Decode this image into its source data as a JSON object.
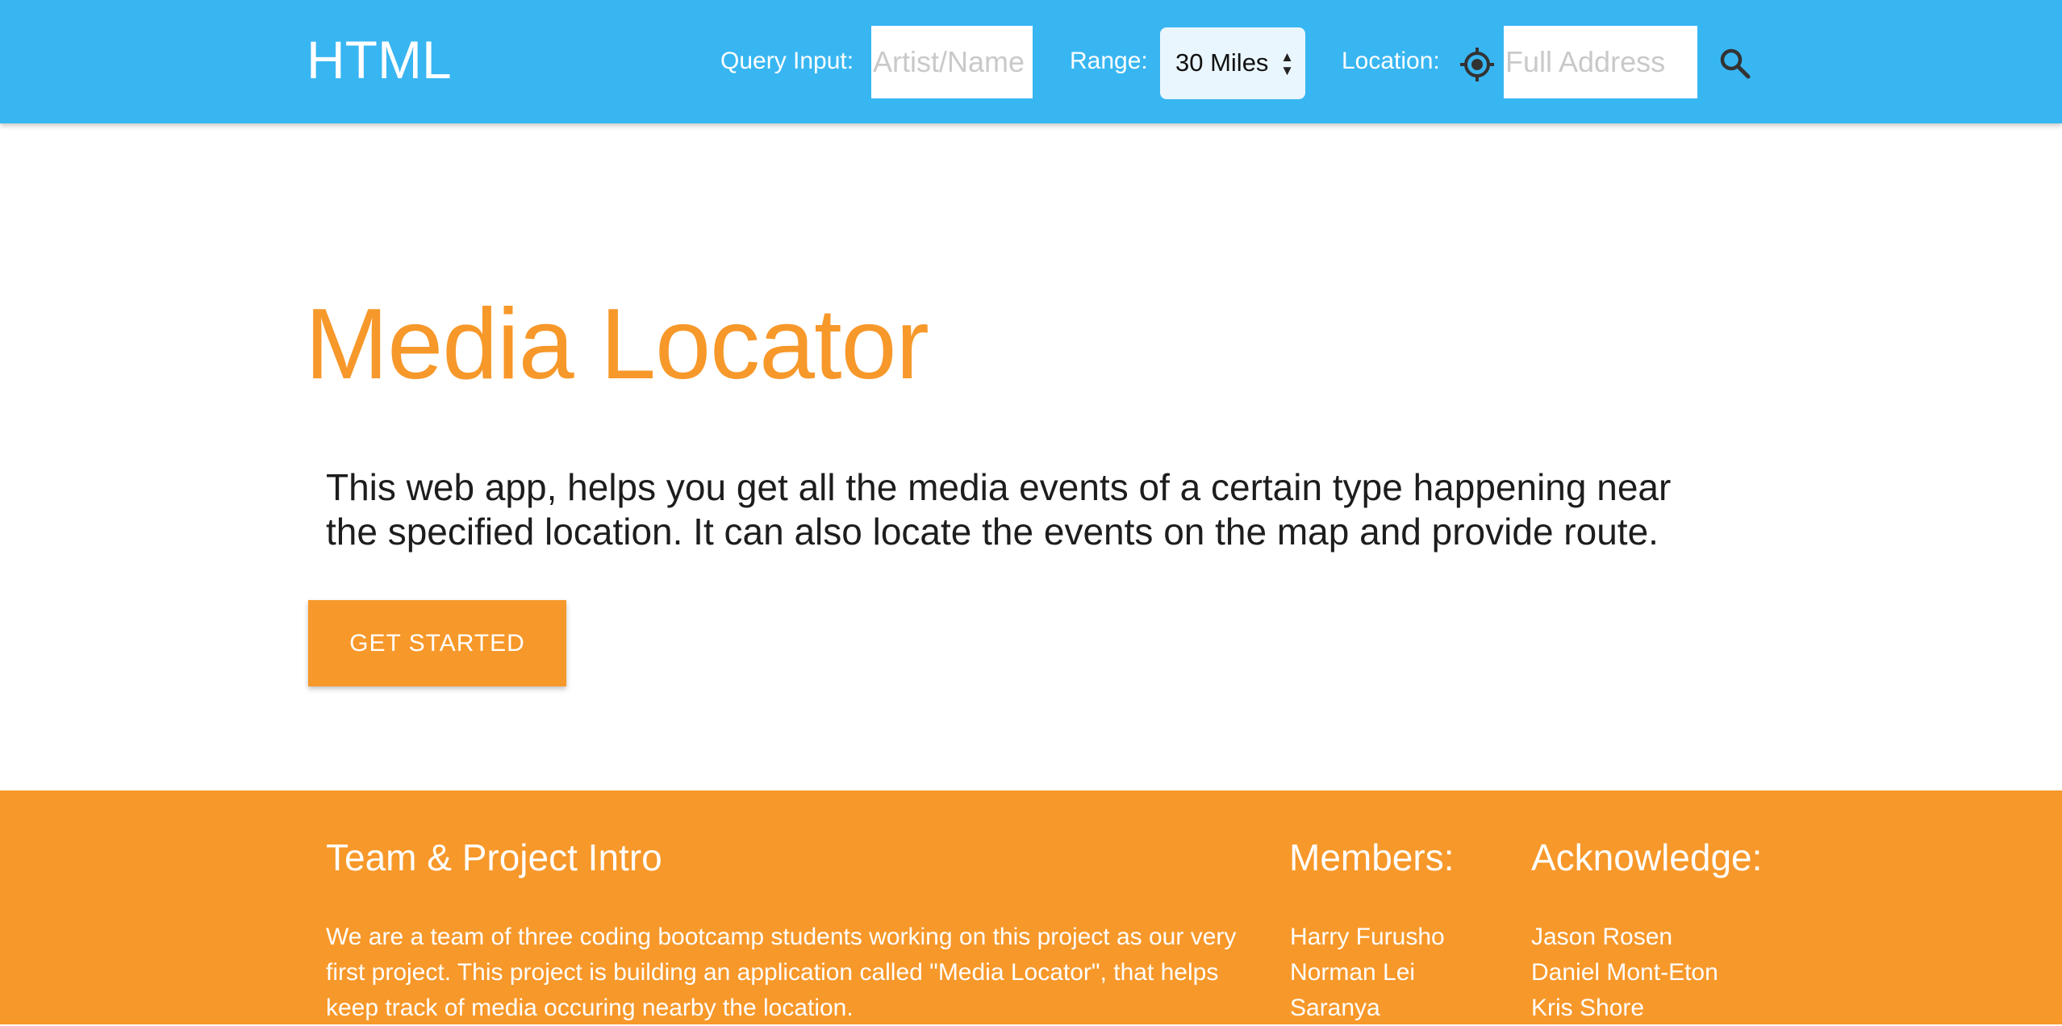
{
  "navbar": {
    "brand": "HTML",
    "query_label": "Query Input:",
    "query_placeholder": "Artist/Name",
    "range_label": "Range:",
    "range_value": "30 Miles",
    "location_label": "Location:",
    "location_placeholder": "Full Address",
    "icons": {
      "locate": "crosshair-target-icon",
      "search": "magnifier-search-icon"
    }
  },
  "hero": {
    "title": "Media Locator",
    "description": "This web app, helps you get all the media events of a certain type happening near the specified location. It can also locate the events on the map and provide route.",
    "cta_label": "GET STARTED"
  },
  "footer": {
    "intro_heading": "Team & Project Intro",
    "intro_text": "We are a team of three coding bootcamp students working on this project as our very first project. This project is building an application called \"Media Locator\", that helps keep track of media occuring nearby the location.",
    "members_heading": "Members:",
    "members": [
      "Harry Furusho",
      "Norman Lei",
      "Saranya"
    ],
    "acknowledge_heading": "Acknowledge:",
    "acknowledge": [
      "Jason Rosen",
      "Daniel Mont-Eton",
      "Kris Shore"
    ]
  },
  "colors": {
    "navbar": "#38b6f2",
    "accent": "#f7982a",
    "text": "#1d1d1d"
  }
}
